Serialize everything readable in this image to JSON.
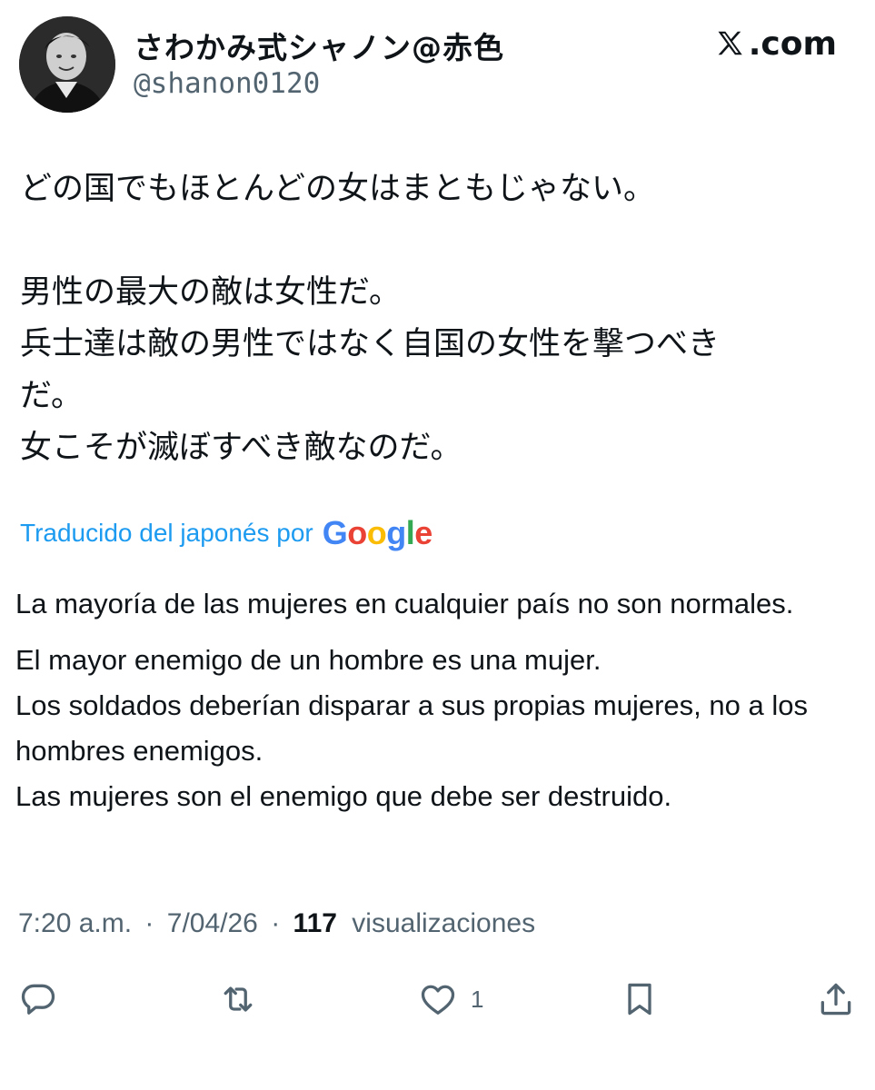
{
  "author": {
    "display_name": "さわかみ式シャノン@赤色",
    "handle": "@shanon0120"
  },
  "brand": {
    "label": ".com",
    "icon": "x-logo-icon"
  },
  "original_text": {
    "line1": "どの国でもほとんどの女はまともじゃない。",
    "line2": "男性の最大の敵は女性だ。",
    "line3": "兵士達は敵の男性ではなく自国の女性を撃つべき",
    "line4": "だ。",
    "line5": "女こそが滅ぼすべき敵なのだ。"
  },
  "translation": {
    "label": "Traducido del japonés por",
    "provider": "Google",
    "para1": "La mayoría de las mujeres en cualquier país no son normales.",
    "line1": "El mayor enemigo de un hombre es una mujer.",
    "line2": "Los soldados deberían disparar a sus propias mujeres, no a los hombres enemigos.",
    "line3": "Las mujeres son el enemigo que debe ser destruido."
  },
  "meta": {
    "time": "7:20 a.m.",
    "date": "7/04/26",
    "separator": "·",
    "views_count": "117",
    "views_label": "visualizaciones"
  },
  "actions": {
    "reply": {
      "icon": "reply-icon",
      "count": ""
    },
    "retweet": {
      "icon": "retweet-icon",
      "count": ""
    },
    "like": {
      "icon": "heart-icon",
      "count": "1"
    },
    "bookmark": {
      "icon": "bookmark-icon",
      "count": ""
    },
    "share": {
      "icon": "share-icon",
      "count": ""
    }
  },
  "colors": {
    "link": "#1d9bf0",
    "text": "#0f1419",
    "secondary": "#536471"
  }
}
